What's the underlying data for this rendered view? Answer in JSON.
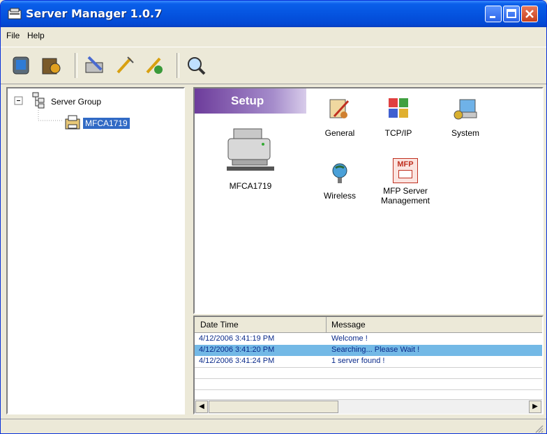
{
  "window": {
    "title": "Server Manager 1.0.7"
  },
  "menu": {
    "items": [
      "File",
      "Help"
    ]
  },
  "toolbar": {
    "icons": [
      "server-icon",
      "settings-server-icon",
      "configure-icon",
      "wand-icon",
      "wand-remove-icon",
      "search-icon"
    ]
  },
  "tree": {
    "root": "Server Group",
    "child": "MFCA1719"
  },
  "setup": {
    "title": "Setup",
    "device": "MFCA1719",
    "items": [
      {
        "label": "General",
        "icon": "general-icon"
      },
      {
        "label": "TCP/IP",
        "icon": "tcpip-icon"
      },
      {
        "label": "System",
        "icon": "system-icon"
      },
      {
        "label": "Wireless",
        "icon": "wireless-icon"
      },
      {
        "label": "MFP Server Management",
        "icon": "mfp-icon",
        "icon_text": "MFP"
      }
    ]
  },
  "log": {
    "columns": [
      "Date Time",
      "Message"
    ],
    "rows": [
      {
        "time": "4/12/2006 3:41:19 PM",
        "message": "Welcome !"
      },
      {
        "time": "4/12/2006 3:41:20 PM",
        "message": "Searching... Please Wait !",
        "selected": true
      },
      {
        "time": "4/12/2006 3:41:24 PM",
        "message": "1 server found !"
      }
    ]
  },
  "status": {
    "text": ""
  }
}
